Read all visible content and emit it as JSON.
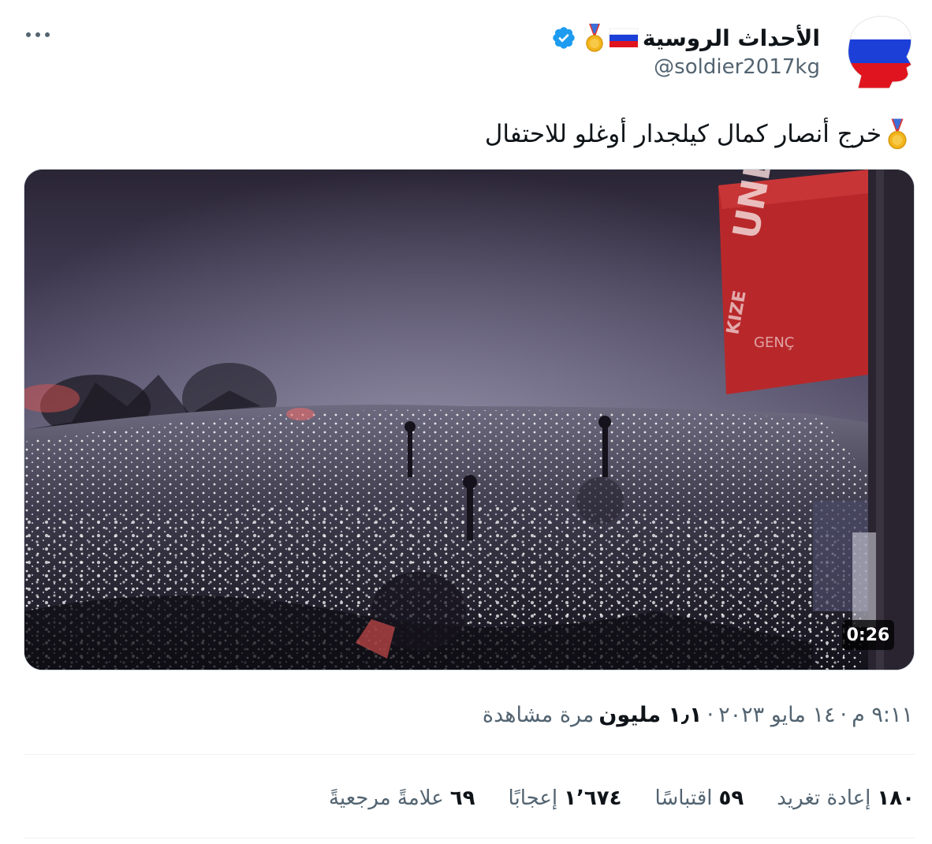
{
  "author": {
    "display_name": "الأحداث الروسية",
    "handle": "@soldier2017kg",
    "icons": [
      "russia-flag-icon",
      "medal-icon",
      "verified-badge-icon"
    ],
    "verified_color": "#1d9bf0"
  },
  "tweet": {
    "text": "خرج أنصار كمال كيلجدار أوغلو للاحتفال"
  },
  "media": {
    "type": "video",
    "duration": "0:26"
  },
  "meta": {
    "time": "٩:١١ م",
    "separator": "·",
    "date": "١٤ مايو ٢٠٢٣",
    "views_count": "١٫١ مليون",
    "views_label": "مرة مشاهدة"
  },
  "stats": [
    {
      "count": "١٨٠",
      "label": "إعادة تغريد"
    },
    {
      "count": "٥٩",
      "label": "اقتباسًا"
    },
    {
      "count": "١٬٦٧٤",
      "label": "إعجابًا"
    },
    {
      "count": "٦٩",
      "label": "علامةً مرجعيةً"
    }
  ]
}
